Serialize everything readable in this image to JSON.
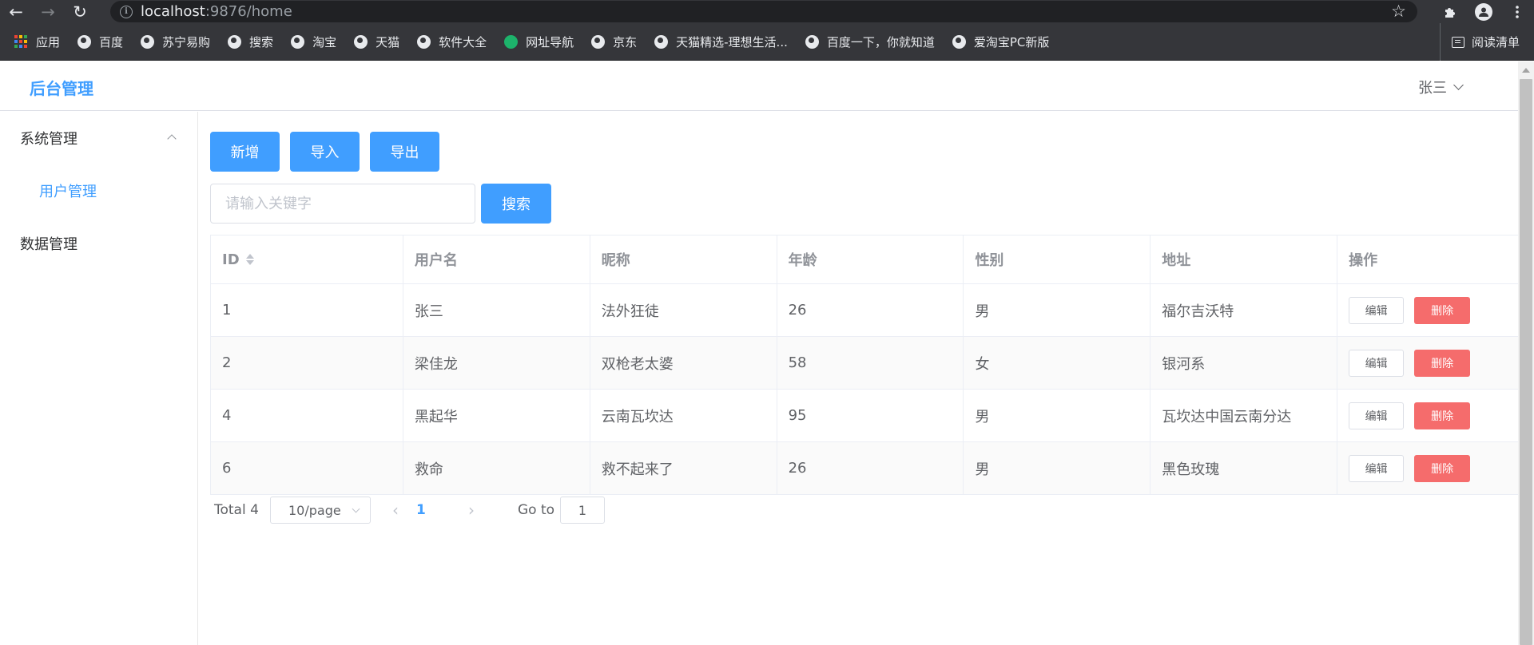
{
  "browser": {
    "url_host": "localhost",
    "url_rest": ":9876/home",
    "bookmarks": [
      {
        "label": "应用",
        "icon": "apps-grid-icon"
      },
      {
        "label": "百度",
        "icon": "globe-icon"
      },
      {
        "label": "苏宁易购",
        "icon": "globe-icon"
      },
      {
        "label": "搜索",
        "icon": "globe-icon"
      },
      {
        "label": "淘宝",
        "icon": "globe-icon"
      },
      {
        "label": "天猫",
        "icon": "globe-icon"
      },
      {
        "label": "软件大全",
        "icon": "globe-icon"
      },
      {
        "label": "网址导航",
        "icon": "green-leaf-icon"
      },
      {
        "label": "京东",
        "icon": "globe-icon"
      },
      {
        "label": "天猫精选-理想生活...",
        "icon": "globe-icon"
      },
      {
        "label": "百度一下，你就知道",
        "icon": "globe-icon"
      },
      {
        "label": "爱淘宝PC新版",
        "icon": "globe-icon"
      }
    ],
    "reading_list": "阅读清单"
  },
  "header": {
    "brand": "后台管理",
    "user_name": "张三"
  },
  "sidebar": {
    "group_system": "系统管理",
    "item_users": "用户管理",
    "group_data": "数据管理"
  },
  "toolbar": {
    "add_label": "新增",
    "import_label": "导入",
    "export_label": "导出",
    "search_placeholder": "请输入关键字",
    "search_label": "搜索"
  },
  "table": {
    "columns": [
      "ID",
      "用户名",
      "昵称",
      "年龄",
      "性别",
      "地址",
      "操作"
    ],
    "edit_label": "编辑",
    "delete_label": "删除",
    "rows": [
      {
        "id": "1",
        "username": "张三",
        "nickname": "法外狂徒",
        "age": "26",
        "gender": "男",
        "address": "福尔吉沃特"
      },
      {
        "id": "2",
        "username": "梁佳龙",
        "nickname": "双枪老太婆",
        "age": "58",
        "gender": "女",
        "address": "银河系"
      },
      {
        "id": "4",
        "username": "黑起华",
        "nickname": "云南瓦坎达",
        "age": "95",
        "gender": "男",
        "address": "瓦坎达中国云南分达"
      },
      {
        "id": "6",
        "username": "救命",
        "nickname": "救不起来了",
        "age": "26",
        "gender": "男",
        "address": "黑色玫瑰"
      }
    ]
  },
  "pagination": {
    "total": "Total 4",
    "page_size": "10/page",
    "current_page": "1",
    "goto_label": "Go to",
    "goto_value": "1"
  },
  "colors": {
    "primary": "#409eff",
    "danger": "#f56c6c",
    "chrome": "#35363a"
  }
}
